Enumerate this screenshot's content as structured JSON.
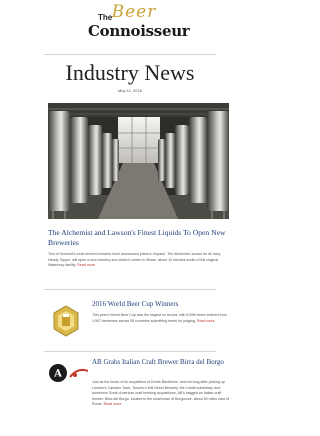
{
  "header": {
    "logo_the": "The",
    "logo_beer": "Beer",
    "logo_connoisseur": "Connoisseur"
  },
  "title": "Industry News",
  "date": "May 11, 2016",
  "articles": [
    {
      "title": "The Alchemist and Lawson's Finest Liquids To Open New Breweries",
      "body": "Two of Vermont's most revered brewers have announced plans to expand. The Alchemist, known for its hazy Heady Topper, will open a new brewery and visitor's center in Stowe, about 10 minutes south of the original Waterbury facility.",
      "read_more": "Read more"
    },
    {
      "title": "2016 World Beer Cup Winners",
      "body": "This year's World Beer Cup was the largest on record, with 6,596 beers entered from 1,907 breweries across 55 countries submitting beers for judging.",
      "read_more": "Read more"
    },
    {
      "title": "AB Grabs Italian Craft Brewer Birra del Borgo",
      "body": "Just as the boom of its acquisition of Devils Backbone, and not long after picking up London's Camden Town, Toronto's Mill Street Brewery, the Lobatt subsidiary and numerous South American craft brewing acquisitions, AB's bagged an Italian craft brewer. Birra del Borgo, located in the small town of Borgorose, about 80 miles east of Rome.",
      "read_more": "Read more"
    }
  ],
  "badge": {
    "top_text": "WORLD",
    "bottom_text": "BEER CUP"
  },
  "logos": {
    "brand": "Anheuser-Busch"
  }
}
